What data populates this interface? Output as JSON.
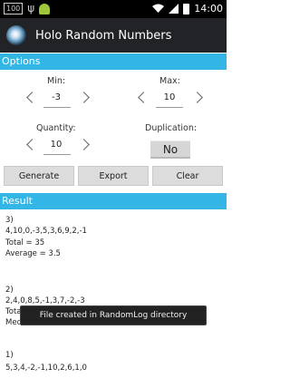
{
  "status_bar": {
    "badge": "100",
    "usb": "ψ",
    "time": "14:00"
  },
  "app": {
    "title": "Holo Random Numbers"
  },
  "options": {
    "header": "Options",
    "min": {
      "label": "Min:",
      "value": "-3"
    },
    "max": {
      "label": "Max:",
      "value": "10"
    },
    "quantity": {
      "label": "Quantity:",
      "value": "10"
    },
    "duplication": {
      "label": "Duplication:",
      "value": "No"
    }
  },
  "buttons": {
    "generate": "Generate",
    "export": "Export",
    "clear": "Clear"
  },
  "result": {
    "header": "Result",
    "lines": [
      "3)",
      "4,10,0,-3,5,3,6,9,2,-1",
      "Total = 35",
      "Average = 3.5",
      "2)",
      "2,4,0,8,5,-1,3,7,-2,-3",
      "Total = 23",
      "Med",
      "1)",
      "5,3,4,-2,-1,10,2,6,1,0"
    ]
  },
  "toast": "File created in RandomLog directory",
  "colors": {
    "accent": "#33b5e5",
    "action_bar": "#222326"
  }
}
